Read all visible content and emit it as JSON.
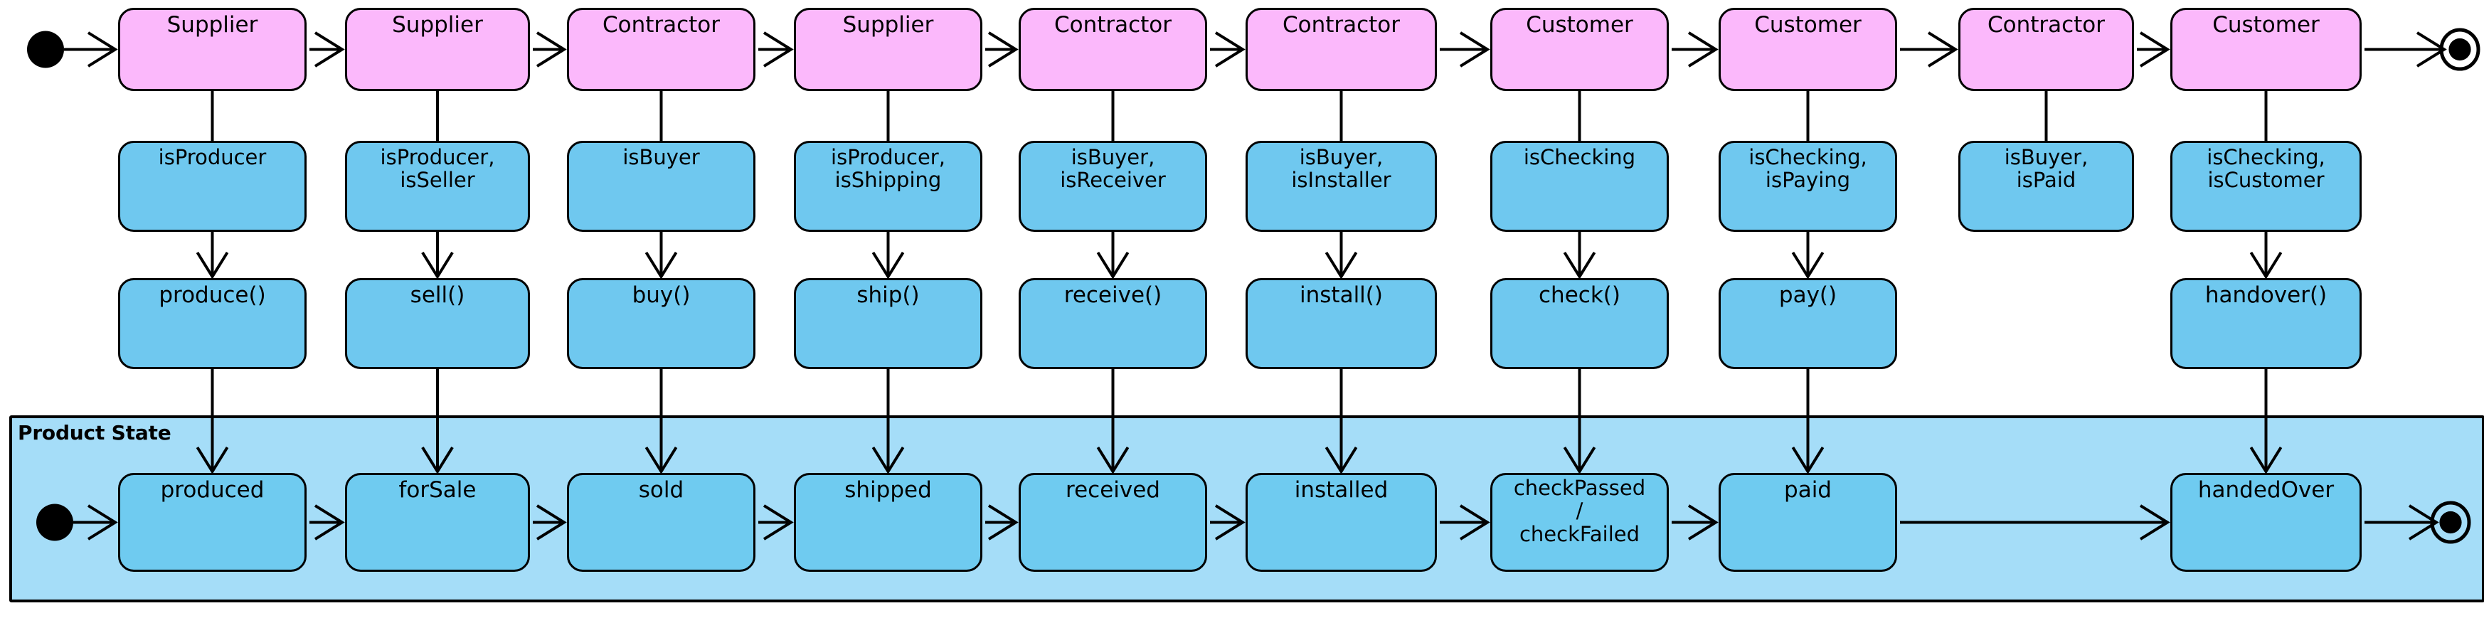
{
  "diagram": {
    "title": "",
    "colors": {
      "role_fill": "#fbb8fb",
      "node_fill": "#6fc8ef",
      "region_fill": "#a5ddf8",
      "stroke": "#000000",
      "background": "#ffffff"
    }
  },
  "region": {
    "label": "Product State"
  },
  "markers": {
    "top_initial": "initial-node",
    "top_final": "final-node",
    "state_initial": "initial-node",
    "state_final": "final-node"
  },
  "columns": [
    {
      "role": "Supplier",
      "condition": "isProducer",
      "method": "produce()",
      "state": "produced"
    },
    {
      "role": "Supplier",
      "condition": "isProducer,\nisSeller",
      "method": "sell()",
      "state": "forSale"
    },
    {
      "role": "Contractor",
      "condition": "isBuyer",
      "method": "buy()",
      "state": "sold"
    },
    {
      "role": "Supplier",
      "condition": "isProducer,\nisShipping",
      "method": "ship()",
      "state": "shipped"
    },
    {
      "role": "Contractor",
      "condition": "isBuyer,\nisReceiver",
      "method": "receive()",
      "state": "received"
    },
    {
      "role": "Contractor",
      "condition": "isBuyer,\nisInstaller",
      "method": "install()",
      "state": "installed"
    },
    {
      "role": "Customer",
      "condition": "isChecking",
      "method": "check()",
      "state": "checkPassed\n/\ncheckFailed"
    },
    {
      "role": "Customer",
      "condition": "isChecking,\nisPaying",
      "method": "pay()",
      "state": "paid"
    },
    {
      "role": "Contractor",
      "condition": "isBuyer,\nisPaid",
      "method": "",
      "state": ""
    },
    {
      "role": "Customer",
      "condition": "isChecking,\nisCustomer",
      "method": "handover()",
      "state": "handedOver"
    }
  ]
}
